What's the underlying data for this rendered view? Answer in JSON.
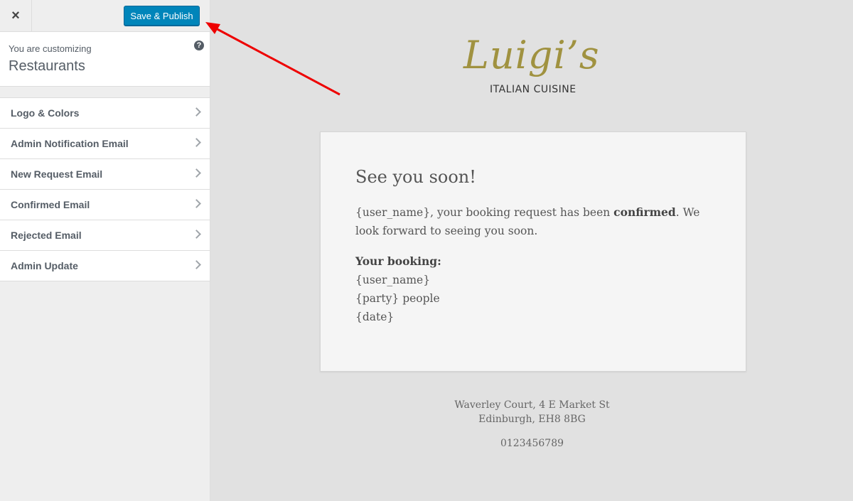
{
  "sidebar": {
    "close_label": "×",
    "save_label": "Save & Publish",
    "customizing_label": "You are customizing",
    "customizing_title": "Restaurants",
    "help_label": "?",
    "items": [
      {
        "label": "Logo & Colors"
      },
      {
        "label": "Admin Notification Email"
      },
      {
        "label": "New Request Email"
      },
      {
        "label": "Confirmed Email"
      },
      {
        "label": "Rejected Email"
      },
      {
        "label": "Admin Update"
      }
    ]
  },
  "preview": {
    "logo_script": "Luigi’s",
    "logo_subtitle": "ITALIAN CUISINE",
    "heading": "See you soon!",
    "body_prefix": "{user_name}, your booking request has been ",
    "body_bold": "confirmed",
    "body_suffix": ". We look forward to seeing you soon.",
    "booking_label": "Your booking:",
    "booking_lines": [
      "{user_name}",
      "{party} people",
      "{date}"
    ],
    "address_line1": "Waverley Court, 4 E Market St",
    "address_line2": "Edinburgh, EH8 8BG",
    "phone": "0123456789"
  },
  "colors": {
    "save_button": "#0085ba",
    "annotation_arrow": "#ee0000",
    "logo_gold": "#a09240"
  }
}
